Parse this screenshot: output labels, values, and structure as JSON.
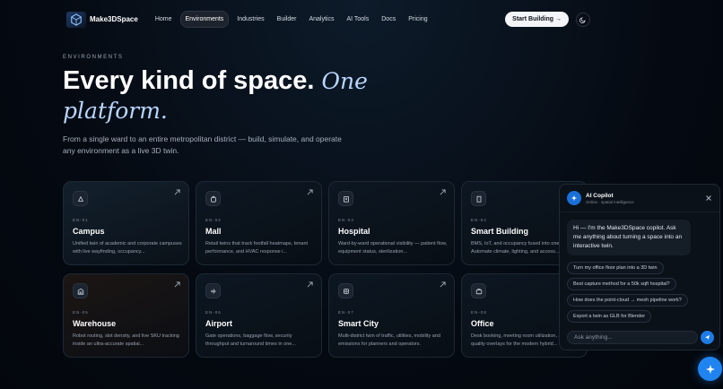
{
  "nav": {
    "brand": "Make3DSpace",
    "items": [
      {
        "label": "Home",
        "active": false
      },
      {
        "label": "Environments",
        "active": true
      },
      {
        "label": "Industries",
        "active": false
      },
      {
        "label": "Builder",
        "active": false
      },
      {
        "label": "Analytics",
        "active": false
      },
      {
        "label": "AI Tools",
        "active": false
      },
      {
        "label": "Docs",
        "active": false
      },
      {
        "label": "Pricing",
        "active": false
      }
    ],
    "cta": "Start Building →"
  },
  "hero": {
    "eyebrow": "ENVIRONMENTS",
    "title": "Every kind of space.",
    "title_accent": "One platform.",
    "subtitle": "From a single ward to an entire metropolitan district — build, simulate, and operate any environment as a live 3D twin."
  },
  "cards": [
    {
      "code": "EN-01",
      "title": "Campus",
      "desc": "Unified twin of academic and corporate campuses with live wayfinding, occupancy..."
    },
    {
      "code": "EN-02",
      "title": "Mall",
      "desc": "Retail twins that track footfall heatmaps, tenant performance, and HVAC response i..."
    },
    {
      "code": "EN-03",
      "title": "Hospital",
      "desc": "Ward-by-ward operational visibility — patient flow, equipment status, sterilization..."
    },
    {
      "code": "EN-04",
      "title": "Smart Building",
      "desc": "BMS, IoT, and occupancy fused into one twin. Automate climate, lighting, and access..."
    },
    {
      "code": "EN-05",
      "title": "Warehouse",
      "desc": "Robot routing, slot density, and live SKU tracking inside an ultra-accurate spatial..."
    },
    {
      "code": "EN-06",
      "title": "Airport",
      "desc": "Gate operations, baggage flow, security throughput and turnaround times in one..."
    },
    {
      "code": "EN-07",
      "title": "Smart City",
      "desc": "Multi-district twin of traffic, utilities, mobility and emissions for planners and operators."
    },
    {
      "code": "EN-08",
      "title": "Office",
      "desc": "Desk booking, meeting room utilization, and air-quality overlays for the modern hybrid..."
    }
  ],
  "chat": {
    "title": "AI Copilot",
    "status": "Online · spatial intelligence",
    "greeting": "Hi — I'm the Make3DSpace copilot. Ask me anything about turning a space into an interactive twin.",
    "suggestions": [
      "Turn my office floor plan into a 3D twin",
      "Best capture method for a 50k sqft hospital?",
      "How does the point-cloud → mesh pipeline work?",
      "Export a twin as GLB for Blender"
    ],
    "input_placeholder": "Ask anything..."
  }
}
